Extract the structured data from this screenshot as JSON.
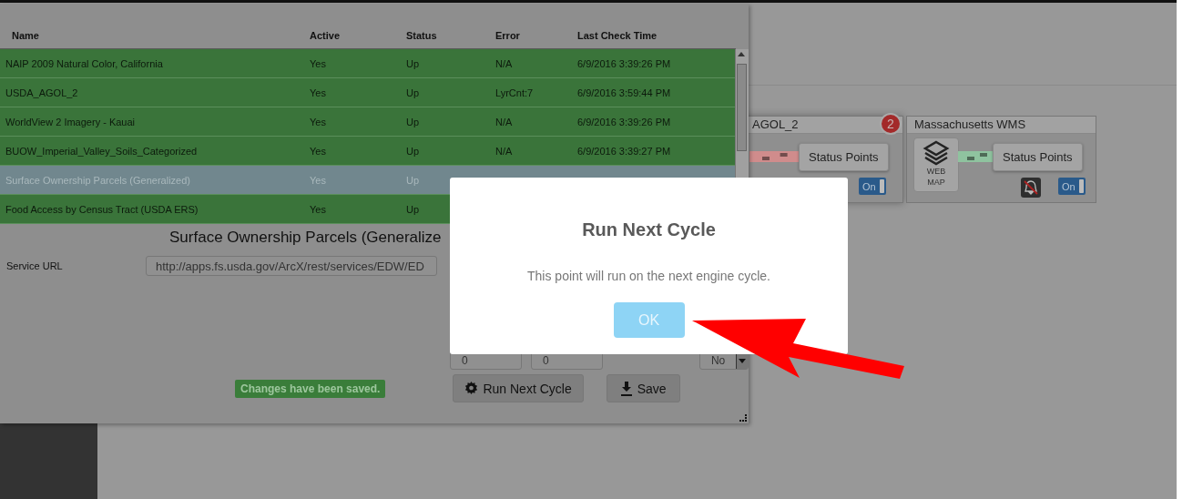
{
  "table": {
    "columns": [
      "Name",
      "Active",
      "Status",
      "Error",
      "Last Check Time"
    ],
    "rows": [
      {
        "name": "NAIP 2009 Natural Color, California",
        "active": "Yes",
        "status": "Up",
        "error": "N/A",
        "last_check": "6/9/2016 3:39:26 PM",
        "selected": false
      },
      {
        "name": "USDA_AGOL_2",
        "active": "Yes",
        "status": "Up",
        "error": "LyrCnt:7",
        "last_check": "6/9/2016 3:59:44 PM",
        "selected": false
      },
      {
        "name": "WorldView 2 Imagery - Kauai",
        "active": "Yes",
        "status": "Up",
        "error": "N/A",
        "last_check": "6/9/2016 3:39:26 PM",
        "selected": false
      },
      {
        "name": "BUOW_Imperial_Valley_Soils_Categorized",
        "active": "Yes",
        "status": "Up",
        "error": "N/A",
        "last_check": "6/9/2016 3:39:27 PM",
        "selected": false
      },
      {
        "name": "Surface Ownership Parcels (Generalized)",
        "active": "Yes",
        "status": "Up",
        "selected": true
      },
      {
        "name": "Food Access by Census Tract (USDA ERS)",
        "active": "Yes",
        "status": "Up",
        "selected": false
      }
    ]
  },
  "detail": {
    "title": "Surface Ownership Parcels (Generalize",
    "url_label": "Service URL",
    "url": "http://apps.fs.usda.gov/ArcX/rest/services/EDW/ED",
    "fields": [
      "0",
      "0"
    ],
    "select": "No",
    "save_status": "Changes have been saved.",
    "buttons": [
      {
        "label": "Run Next Cycle",
        "kind": "gear"
      },
      {
        "label": "Save",
        "kind": "download"
      }
    ]
  },
  "cards": [
    {
      "title": "AGOL_2",
      "badge": "2",
      "kind": "service",
      "color": "#d08c8c",
      "button": "Status Points",
      "toggle_label": "On",
      "toggle_on": true
    },
    {
      "title": "Massachusetts WMS",
      "kind": "webmap",
      "icon_label": "WEB MAP",
      "color": "#8fc39f",
      "button": "Status Points",
      "alerts_muted": true,
      "toggle_label": "On",
      "toggle_on": true
    }
  ],
  "modal": {
    "title": "Run Next Cycle",
    "message": "This point will run on the next engine cycle.",
    "button": "OK"
  }
}
